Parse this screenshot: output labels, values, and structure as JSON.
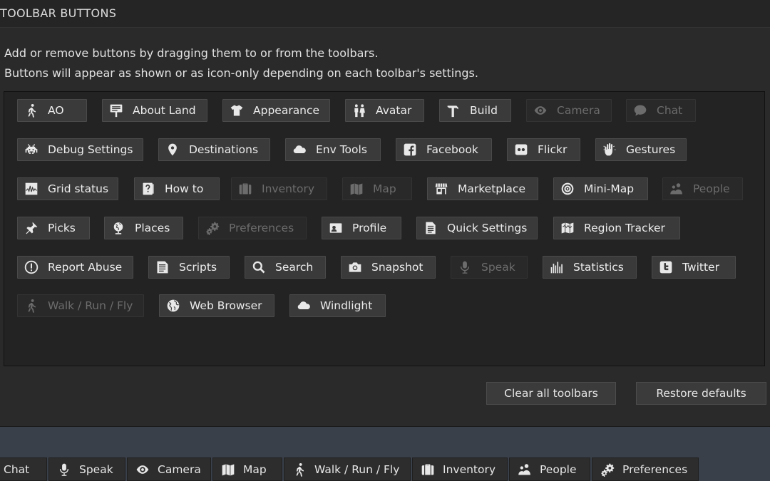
{
  "window": {
    "title": "TOOLBAR BUTTONS"
  },
  "instructions": {
    "line1": "Add or remove buttons by dragging them to or from the toolbars.",
    "line2": "Buttons will appear as shown or as icon-only depending on each toolbar's settings."
  },
  "buttons": [
    {
      "label": "AO",
      "icon": "walk-icon"
    },
    {
      "label": "About Land",
      "icon": "sign-icon"
    },
    {
      "label": "Appearance",
      "icon": "shirt-icon"
    },
    {
      "label": "Avatar",
      "icon": "people-pair-icon"
    },
    {
      "label": "Build",
      "icon": "hammer-icon"
    },
    {
      "label": "Camera",
      "icon": "eye-icon",
      "disabled": true
    },
    {
      "label": "Chat",
      "icon": "speech-bubble-icon",
      "disabled": true
    },
    {
      "label": "Debug Settings",
      "icon": "space-invader-icon"
    },
    {
      "label": "Destinations",
      "icon": "map-pin-icon"
    },
    {
      "label": "Env Tools",
      "icon": "cloud-icon"
    },
    {
      "label": "Facebook",
      "icon": "facebook-icon"
    },
    {
      "label": "Flickr",
      "icon": "flickr-icon"
    },
    {
      "label": "Gestures",
      "icon": "hand-icon"
    },
    {
      "label": "Grid status",
      "icon": "grid-status-icon"
    },
    {
      "label": "How to",
      "icon": "help-book-icon"
    },
    {
      "label": "Inventory",
      "icon": "suitcase-icon",
      "disabled": true
    },
    {
      "label": "Map",
      "icon": "folded-map-icon",
      "disabled": true
    },
    {
      "label": "Marketplace",
      "icon": "storefront-icon"
    },
    {
      "label": "Mini-Map",
      "icon": "radar-icon"
    },
    {
      "label": "People",
      "icon": "people-icon",
      "disabled": true
    },
    {
      "label": "Picks",
      "icon": "pushpin-icon"
    },
    {
      "label": "Places",
      "icon": "globe-icon"
    },
    {
      "label": "Preferences",
      "icon": "gears-icon",
      "disabled": true
    },
    {
      "label": "Profile",
      "icon": "id-card-icon"
    },
    {
      "label": "Quick Settings",
      "icon": "document-icon"
    },
    {
      "label": "Region Tracker",
      "icon": "region-map-icon"
    },
    {
      "label": "Report Abuse",
      "icon": "alert-circle-icon"
    },
    {
      "label": "Scripts",
      "icon": "script-icon"
    },
    {
      "label": "Search",
      "icon": "magnifier-icon"
    },
    {
      "label": "Snapshot",
      "icon": "camera-icon"
    },
    {
      "label": "Speak",
      "icon": "microphone-icon",
      "disabled": true
    },
    {
      "label": "Statistics",
      "icon": "bar-chart-icon"
    },
    {
      "label": "Twitter",
      "icon": "twitter-icon"
    },
    {
      "label": "Walk / Run / Fly",
      "icon": "walk-icon",
      "disabled": true
    },
    {
      "label": "Web Browser",
      "icon": "web-globe-icon"
    },
    {
      "label": "Windlight",
      "icon": "cloud-icon"
    }
  ],
  "actions": {
    "clear_all": "Clear all toolbars",
    "restore_defaults": "Restore defaults"
  },
  "bottom_toolbar": [
    {
      "label": "Chat",
      "icon": "speech-bubble-icon"
    },
    {
      "label": "Speak",
      "icon": "microphone-icon"
    },
    {
      "label": "Camera",
      "icon": "eye-icon"
    },
    {
      "label": "Map",
      "icon": "folded-map-icon"
    },
    {
      "label": "Walk / Run / Fly",
      "icon": "walk-icon"
    },
    {
      "label": "Inventory",
      "icon": "suitcase-icon"
    },
    {
      "label": "People",
      "icon": "people-icon"
    },
    {
      "label": "Preferences",
      "icon": "gears-icon"
    }
  ]
}
